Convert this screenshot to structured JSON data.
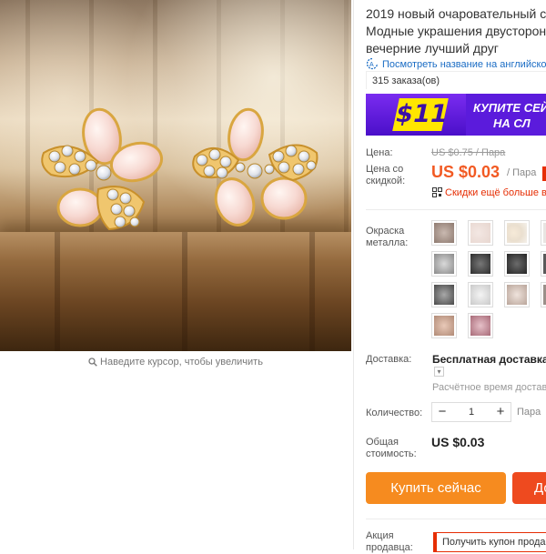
{
  "product": {
    "title_lines": [
      "2019 новый очаровательный со",
      "Модные украшения двусторонн",
      "вечерние лучший друг"
    ],
    "translate_link": "Посмотреть название на английско",
    "orders": "315 заказа(ов)"
  },
  "banner": {
    "amount": "$11",
    "text_line1": "КУПИТЕ СЕЙ",
    "text_line2": "НА СЛ"
  },
  "gallery": {
    "zoom_hint": "Наведите курсор, чтобы увеличить"
  },
  "pricing": {
    "price_label": "Цена:",
    "old_price": "US $0.75 / Пара",
    "sale_label": "Цена со скидкой:",
    "sale_price": "US $0.03",
    "unit": "/ Пара",
    "coupon_text": "Скидки ещё больше в"
  },
  "options": {
    "color_label": "Окраска металла:",
    "thumb_count": 15
  },
  "shipping": {
    "label": "Доставка:",
    "value": "Бесплатная доставка в Р",
    "time": "Расчётное время доставк"
  },
  "quantity": {
    "label": "Количество:",
    "minus": "−",
    "value": "1",
    "plus": "+",
    "unit": "Пара"
  },
  "total": {
    "label": "Общая стоимость:",
    "value": "US $0.03"
  },
  "actions": {
    "buy_now": "Купить сейчас",
    "add_to_cart": "До"
  },
  "seller_promo": {
    "label": "Акция продавца:",
    "coupon": "Получить купон прода"
  },
  "colors": {
    "accent": "#f25a23",
    "buy_button": "#f68b1f",
    "cart_button": "#ee4a1f",
    "link": "#1a6cc4",
    "banner_purple": "#5b1bdc",
    "banner_yellow": "#ffe600"
  }
}
